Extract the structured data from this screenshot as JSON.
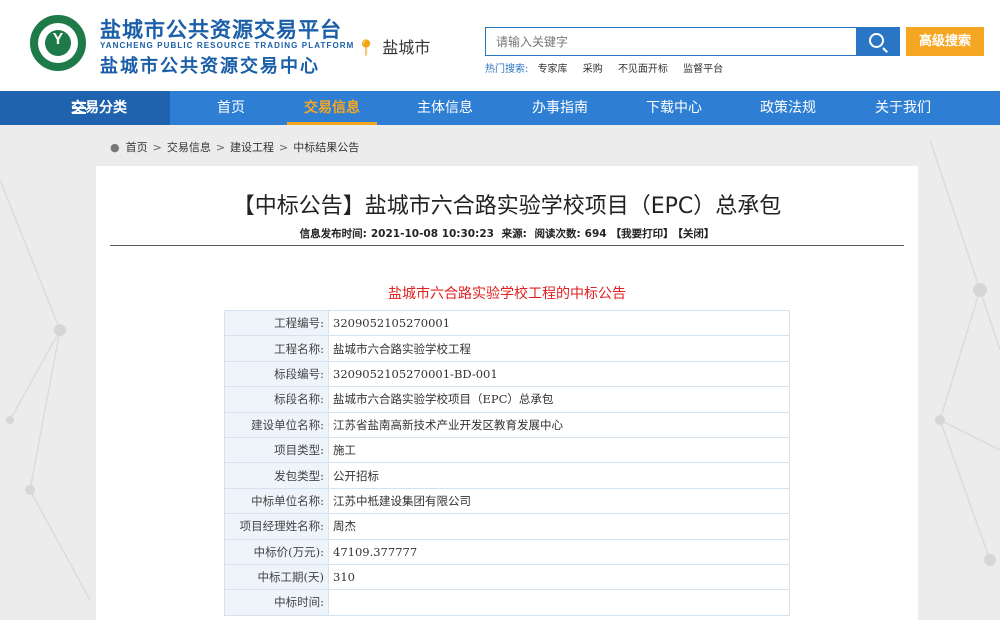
{
  "site": {
    "title_cn": "盐城市公共资源交易平台",
    "title_en": "YANCHENG PUBLIC RESOURCE TRADING PLATFORM",
    "title_cn2": "盐城市公共资源交易中心",
    "city": "盐城市"
  },
  "search": {
    "placeholder": "请输入关键字",
    "advanced_label": "高级搜索",
    "hot_label": "热门搜索:",
    "hot_items": [
      "专家库",
      "采购",
      "不见面开标",
      "监督平台"
    ]
  },
  "nav": {
    "category_label": "交易分类",
    "items": [
      {
        "label": "首页",
        "active": false
      },
      {
        "label": "交易信息",
        "active": true
      },
      {
        "label": "主体信息",
        "active": false
      },
      {
        "label": "办事指南",
        "active": false
      },
      {
        "label": "下载中心",
        "active": false
      },
      {
        "label": "政策法规",
        "active": false
      },
      {
        "label": "关于我们",
        "active": false
      }
    ]
  },
  "breadcrumb": [
    "首页",
    "交易信息",
    "建设工程",
    "中标结果公告"
  ],
  "article": {
    "title": "【中标公告】盐城市六合路实验学校项目（EPC）总承包",
    "meta": {
      "publish_label": "信息发布时间:",
      "publish_time": "2021-10-08 10:30:23",
      "source_label": "来源:",
      "reads_label": "阅读次数:",
      "reads": "694",
      "print_label": "【我要打印】",
      "close_label": "【关闭】"
    },
    "subtitle": "盐城市六合路实验学校工程的中标公告",
    "fields": [
      {
        "label": "工程编号:",
        "value": "3209052105270001"
      },
      {
        "label": "工程名称:",
        "value": "盐城市六合路实验学校工程"
      },
      {
        "label": "标段编号:",
        "value": "3209052105270001-BD-001"
      },
      {
        "label": "标段名称:",
        "value": "盐城市六合路实验学校项目（EPC）总承包"
      },
      {
        "label": "建设单位名称:",
        "value": "江苏省盐南高新技术产业开发区教育发展中心"
      },
      {
        "label": "项目类型:",
        "value": "施工"
      },
      {
        "label": "发包类型:",
        "value": "公开招标"
      },
      {
        "label": "中标单位名称:",
        "value": "江苏中柢建设集团有限公司"
      },
      {
        "label": "项目经理姓名称:",
        "value": "周杰"
      },
      {
        "label": "中标价(万元):",
        "value": "47109.377777"
      },
      {
        "label": "中标工期(天)",
        "value": "310"
      },
      {
        "label": "中标时间:",
        "value": ""
      }
    ]
  }
}
